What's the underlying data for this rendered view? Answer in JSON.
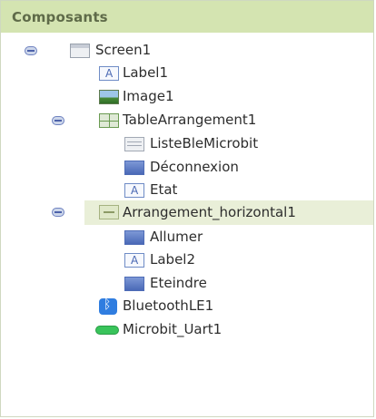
{
  "panel": {
    "title": "Composants"
  },
  "tree": {
    "screen1": {
      "label": "Screen1",
      "icon": "screen-icon"
    },
    "label1": {
      "label": "Label1",
      "icon": "label-icon"
    },
    "image1": {
      "label": "Image1",
      "icon": "image-icon"
    },
    "table_arrangement1": {
      "label": "TableArrangement1",
      "icon": "table-arrangement-icon"
    },
    "liste_ble_microbit": {
      "label": "ListeBleMicrobit",
      "icon": "list-picker-icon"
    },
    "deconnexion": {
      "label": "Déconnexion",
      "icon": "button-icon"
    },
    "etat": {
      "label": "Etat",
      "icon": "label-icon"
    },
    "arrangement_horizontal1": {
      "label": "Arrangement_horizontal1",
      "icon": "horizontal-arrangement-icon",
      "selected": true
    },
    "allumer": {
      "label": "Allumer",
      "icon": "button-icon"
    },
    "label2": {
      "label": "Label2",
      "icon": "label-icon"
    },
    "eteindre": {
      "label": "Eteindre",
      "icon": "button-icon"
    },
    "bluetooth_le1": {
      "label": "BluetoothLE1",
      "icon": "bluetooth-icon"
    },
    "microbit_uart1": {
      "label": "Microbit_Uart1",
      "icon": "uart-icon"
    }
  },
  "colors": {
    "header_bg": "#d4e4b1",
    "selected_bg": "#e9efd8",
    "toggle": "#4d62aa"
  }
}
